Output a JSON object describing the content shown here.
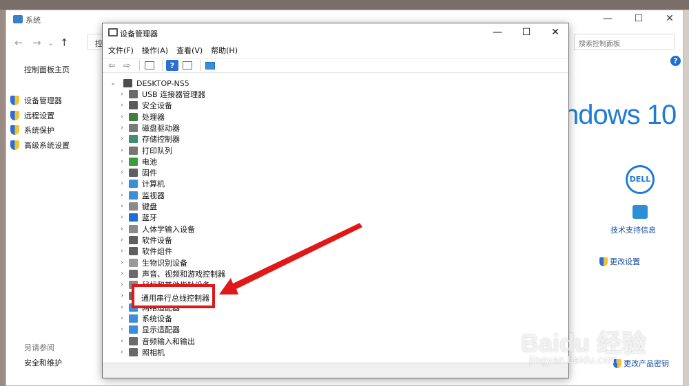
{
  "background_window": {
    "title": "系统",
    "address_prefix": "控",
    "search_placeholder": "搜索控制面板",
    "sidebar": {
      "home": "控制面板主页",
      "links": [
        "设备管理器",
        "远程设置",
        "系统保护",
        "高级系统设置"
      ],
      "see_also": "另请参阅",
      "see_also_link": "安全和维护"
    },
    "windows_logo_text": "ndows 10",
    "oem_logo": "DELL",
    "support_link": "技术支持信息",
    "change_settings": "更改设置",
    "product_key": "更改产品密钥"
  },
  "device_manager": {
    "title": "设备管理器",
    "menu": [
      "文件(F)",
      "操作(A)",
      "查看(V)",
      "帮助(H)"
    ],
    "root": "DESKTOP-NS5",
    "categories": [
      {
        "label": "USB 连接器管理器",
        "icon": "usb-icon",
        "color": "#6a6a6a"
      },
      {
        "label": "安全设备",
        "icon": "security-icon",
        "color": "#5a5a5a"
      },
      {
        "label": "处理器",
        "icon": "processor-icon",
        "color": "#3f7f3f"
      },
      {
        "label": "磁盘驱动器",
        "icon": "disk-icon",
        "color": "#7a7a7a"
      },
      {
        "label": "存储控制器",
        "icon": "storage-icon",
        "color": "#3f8f6f"
      },
      {
        "label": "打印队列",
        "icon": "printer-icon",
        "color": "#777777"
      },
      {
        "label": "电池",
        "icon": "battery-icon",
        "color": "#3d9b3d"
      },
      {
        "label": "固件",
        "icon": "firmware-icon",
        "color": "#5f5f5f"
      },
      {
        "label": "计算机",
        "icon": "computer-icon",
        "color": "#3a8fd8"
      },
      {
        "label": "监视器",
        "icon": "monitor-icon",
        "color": "#3a8fd8"
      },
      {
        "label": "键盘",
        "icon": "keyboard-icon",
        "color": "#8a8a8a"
      },
      {
        "label": "蓝牙",
        "icon": "bluetooth-icon",
        "color": "#1d6fd1"
      },
      {
        "label": "人体学输入设备",
        "icon": "hid-icon",
        "color": "#8a8a8a"
      },
      {
        "label": "软件设备",
        "icon": "software-device-icon",
        "color": "#5f5f5f"
      },
      {
        "label": "软件组件",
        "icon": "software-component-icon",
        "color": "#5f5f5f"
      },
      {
        "label": "生物识别设备",
        "icon": "biometric-icon",
        "color": "#9a9a9a"
      },
      {
        "label": "声音、视频和游戏控制器",
        "icon": "sound-icon",
        "color": "#6a6a6a"
      },
      {
        "label": "鼠标和其他指针设备",
        "icon": "mouse-icon",
        "color": "#8a8a8a"
      },
      {
        "label": "通用串行总线控制器",
        "icon": "usb-controller-icon",
        "color": "#6a6a6a"
      },
      {
        "label": "网络适配器",
        "icon": "network-icon",
        "color": "#3a8fd8"
      },
      {
        "label": "系统设备",
        "icon": "system-device-icon",
        "color": "#3a8fd8"
      },
      {
        "label": "显示适配器",
        "icon": "display-adapter-icon",
        "color": "#3a8fd8"
      },
      {
        "label": "音频输入和输出",
        "icon": "audio-icon",
        "color": "#6a6a6a"
      },
      {
        "label": "照相机",
        "icon": "camera-icon",
        "color": "#6a6a6a"
      }
    ]
  },
  "annotation": {
    "highlighted_label": "通用串行总线控制器",
    "box_color": "#e01818"
  },
  "watermark": {
    "main": "Baidu 经验",
    "sub": "jingyan.baidu.com"
  }
}
